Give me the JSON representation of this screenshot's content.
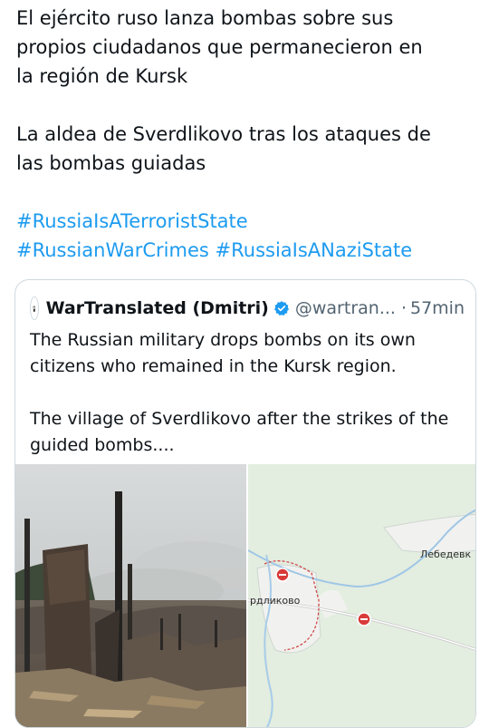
{
  "tweet": {
    "line1": "El ejército ruso lanza bombas sobre sus",
    "line2": "propios ciudadanos que permanecieron en",
    "line3": "la región de Kursk",
    "line4": "La aldea de Sverdlikovo tras los ataques de",
    "line5": "las bombas guiadas",
    "hashtags_line1": [
      "#RussiaIsATerroristState"
    ],
    "hashtags_line2": [
      "#RussianWarCrimes",
      "#RussiaIsANaziState"
    ]
  },
  "quote": {
    "author_name": "WarTranslated (Dmitri)",
    "handle": "@wartran...",
    "separator": "·",
    "time": "57min",
    "text_line1": "The Russian military drops bombs on its own",
    "text_line2": "citizens who remained in the Kursk region.",
    "text_line3": "The village of Sverdlikovo after the strikes of the",
    "text_line4": "guided bombs....",
    "icons": [
      "verified-badge-icon",
      "avatar"
    ]
  },
  "media": {
    "map": {
      "label_village": "рдликово",
      "label_village2": "Лебедевк"
    }
  },
  "colors": {
    "link": "#1d9bf0",
    "text": "#0f1419",
    "muted": "#536471",
    "border": "#cfd9de"
  }
}
